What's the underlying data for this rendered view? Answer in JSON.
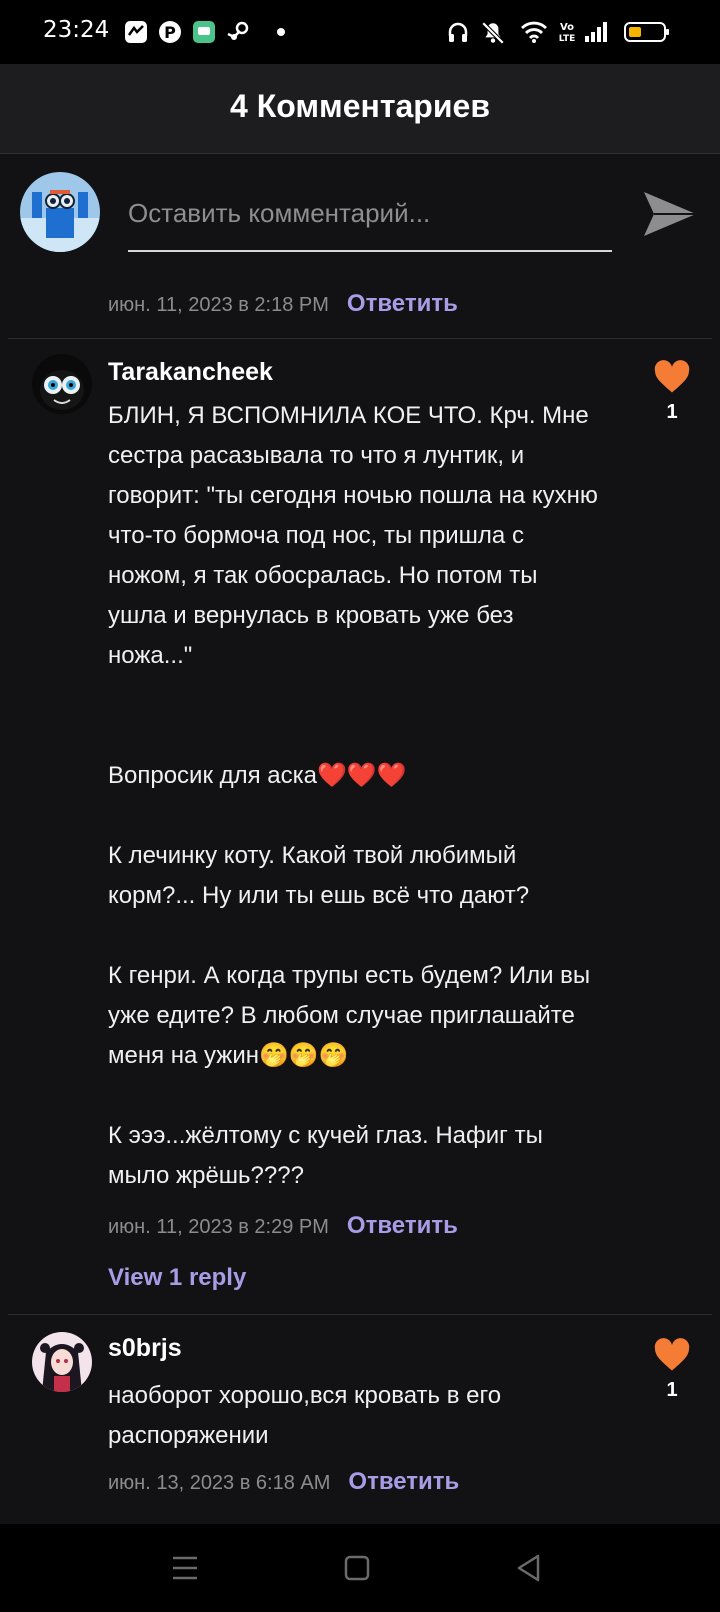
{
  "status_bar": {
    "time": "23:24",
    "icons": [
      "app-icon",
      "pinterest-icon",
      "chat-icon",
      "steam-icon",
      "dot",
      "headphones-icon",
      "mute-icon",
      "wifi-icon",
      "volte-icon",
      "signal-icon",
      "battery-icon"
    ],
    "volte_label": "Vo LTE"
  },
  "header": {
    "title": "4 Комментариев"
  },
  "compose": {
    "placeholder": "Оставить комментарий...",
    "send_icon": "send-icon"
  },
  "previous_comment": {
    "date": "июн. 11, 2023 в 2:18 PM",
    "reply_label": "Ответить"
  },
  "comments": [
    {
      "username": "Tarakancheek",
      "body": "БЛИН, Я ВСПОМНИЛА КОЕ ЧТО. Крч. Мне сестра расазывала то что я лунтик, и говорит: \"ты сегодня ночью пошла на кухню что-то бормоча под нос, ты пришла с ножом, я так обосралась. Но потом ты ушла и вернулась в кровать уже без ножа...\"\n\n\nВопросик для аска❤️❤️❤️\n\nК лечинку коту. Какой твой любимый корм?... Ну или ты ешь всё что дают?\n\nК генри. А когда трупы есть будем? Или вы уже едите? В любом случае приглашайте меня на ужин🤭🤭🤭\n\nК эээ...жёлтому с кучей глаз. Нафиг ты мыло жрёшь????",
      "date": "июн. 11, 2023 в 2:29 PM",
      "reply_label": "Ответить",
      "likes": "1",
      "view_replies": "View 1 reply",
      "like_color": "#f47c34"
    },
    {
      "username": "s0brjs",
      "body": "наоборот хорошо,вся кровать в его распоряжении",
      "date": "июн. 13, 2023 в 6:18 AM",
      "reply_label": "Ответить",
      "likes": "1",
      "like_color": "#f47c34"
    }
  ],
  "colors": {
    "accent": "#a99ce6",
    "like": "#f47c34",
    "background": "#121113",
    "header": "#1d1c1e"
  },
  "nav_bar": {
    "icons": [
      "menu-icon",
      "home-square-icon",
      "back-triangle-icon"
    ]
  }
}
